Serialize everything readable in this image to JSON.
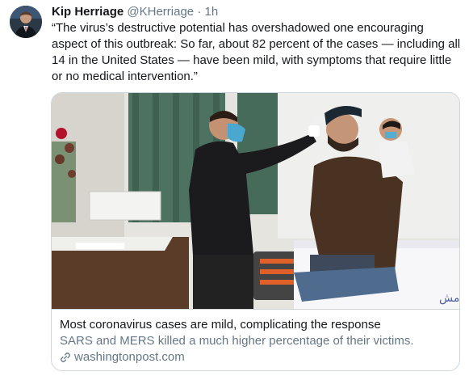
{
  "tweet": {
    "author_name": "Kip Herriage",
    "author_handle": "@KHerriage",
    "separator": "·",
    "time": "1h",
    "text": "“The virus’s destructive potential has overshadowed one encouraging aspect of this outbreak: So far, about 82 percent of the cases — including all 14 in the United States — have been mild, with symptoms that require little or no medical intervention.”"
  },
  "card": {
    "title": "Most coronavirus cases are mild, complicating the response",
    "description": "SARS and MERS killed a much higher percentage of their victims.",
    "domain": "washingtonpost.com",
    "link_icon": "link-icon",
    "image_sign_text": "سة صحة ريف دمش"
  },
  "colors": {
    "primary_text": "#14171a",
    "secondary_text": "#657786",
    "border": "#ccd6dd"
  }
}
